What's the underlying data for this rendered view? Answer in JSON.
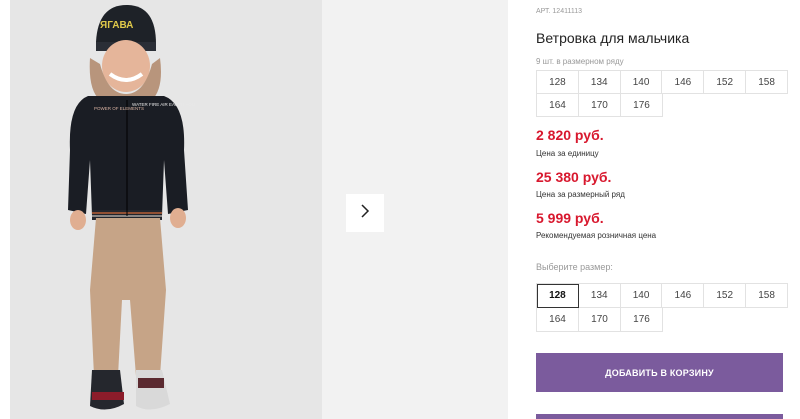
{
  "product": {
    "article": "АРТ. 12411113",
    "title": "Ветровка для мальчика",
    "sizerow_caption": "9 шт. в размерном ряду"
  },
  "size_row": [
    [
      "128",
      "134",
      "140",
      "146",
      "152",
      "158"
    ],
    [
      "164",
      "170",
      "176"
    ]
  ],
  "prices": [
    {
      "value": "2 820 руб.",
      "note": "Цена за единицу"
    },
    {
      "value": "25 380 руб.",
      "note": "Цена за размерный ряд"
    },
    {
      "value": "5 999 руб.",
      "note": "Рекомендуемая розничная цена"
    }
  ],
  "size_picker": {
    "label": "Выберите размер:",
    "selected": "128",
    "rows": [
      [
        "128",
        "134",
        "140",
        "146",
        "152",
        "158"
      ],
      [
        "164",
        "170",
        "176"
      ]
    ]
  },
  "cart": {
    "label": "ДОБАВИТЬ В КОРЗИНУ"
  },
  "jacket_print": {
    "left": "POWER OF ELEMENTS",
    "right": "WATER FIRE AIR EARTH YOU"
  },
  "cap_print": "ЯГАВА",
  "colors": {
    "accent": "#7b5b9d",
    "price": "#d8182e"
  }
}
